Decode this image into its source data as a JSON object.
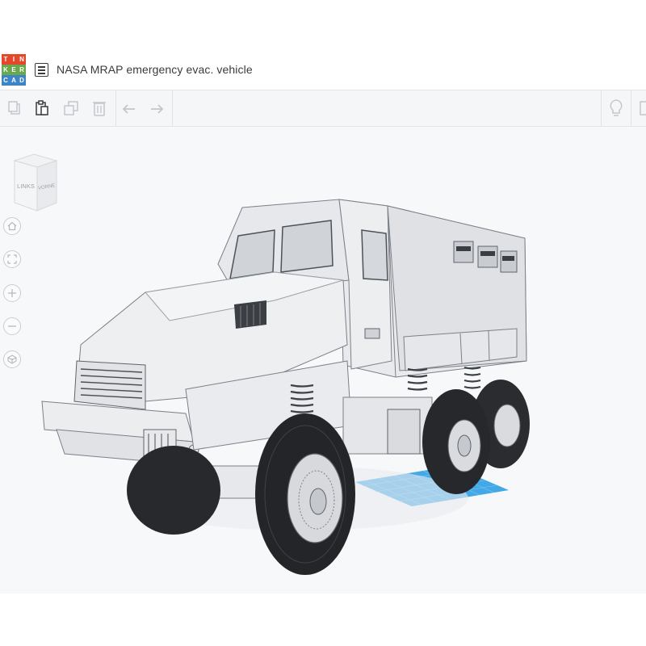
{
  "app": {
    "logo_letters": [
      "T",
      "I",
      "N",
      "K",
      "E",
      "R",
      "C",
      "A",
      "D"
    ],
    "logo_colors": [
      "#e3482c",
      "#e3482c",
      "#e3482c",
      "#6aa84f",
      "#6aa84f",
      "#6aa84f",
      "#3d85c6",
      "#3d85c6",
      "#3d85c6"
    ],
    "project_title": "NASA MRAP emergency evac. vehicle"
  },
  "toolbar": {
    "icons": [
      "copy-icon",
      "paste-icon",
      "duplicate-icon",
      "delete-icon",
      "undo-icon",
      "redo-icon",
      "lightbulb-icon",
      "note-icon"
    ]
  },
  "view_cube": {
    "left_face": "LINKS",
    "right_face": "VORNE"
  },
  "nav_controls": [
    "home-view-icon",
    "fit-view-icon",
    "zoom-in-icon",
    "zoom-out-icon",
    "perspective-icon"
  ],
  "colors": {
    "workplane": "#3aa7e8",
    "model": "#e4e6e9",
    "tires": "#26282b"
  }
}
